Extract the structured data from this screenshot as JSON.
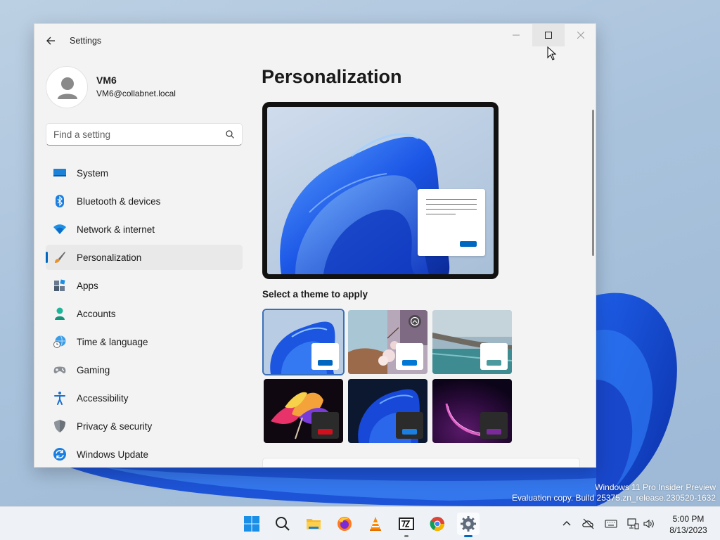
{
  "window": {
    "title": "Settings"
  },
  "user": {
    "name": "VM6",
    "email": "VM6@collabnet.local"
  },
  "search": {
    "placeholder": "Find a setting"
  },
  "nav": {
    "items": [
      {
        "label": "System",
        "icon": "monitor-icon"
      },
      {
        "label": "Bluetooth & devices",
        "icon": "bluetooth-icon"
      },
      {
        "label": "Network & internet",
        "icon": "wifi-icon"
      },
      {
        "label": "Personalization",
        "icon": "brush-icon",
        "active": true
      },
      {
        "label": "Apps",
        "icon": "apps-icon"
      },
      {
        "label": "Accounts",
        "icon": "person-icon"
      },
      {
        "label": "Time & language",
        "icon": "globe-clock-icon"
      },
      {
        "label": "Gaming",
        "icon": "gamepad-icon"
      },
      {
        "label": "Accessibility",
        "icon": "accessibility-icon"
      },
      {
        "label": "Privacy & security",
        "icon": "shield-icon"
      },
      {
        "label": "Windows Update",
        "icon": "update-icon"
      }
    ]
  },
  "main": {
    "title": "Personalization",
    "themes_label": "Select a theme to apply",
    "themes": [
      {
        "name": "windows-light",
        "selected": true
      },
      {
        "name": "glow"
      },
      {
        "name": "captured-motion"
      },
      {
        "name": "sunrise"
      },
      {
        "name": "windows-dark"
      },
      {
        "name": "flow"
      }
    ]
  },
  "watermark": {
    "line1": "Windows 11 Pro Insider Preview",
    "line2": "Evaluation copy. Build 25375.zn_release.230520-1632"
  },
  "taskbar": {
    "apps": [
      "windows-start-icon",
      "search-icon",
      "file-explorer-icon",
      "firefox-icon",
      "vlc-icon",
      "7zip-icon",
      "chrome-icon",
      "settings-icon"
    ],
    "time": "5:00 PM",
    "date": "8/13/2023"
  },
  "colors": {
    "accent": "#0067c0",
    "window_bg": "#f3f3f3"
  }
}
